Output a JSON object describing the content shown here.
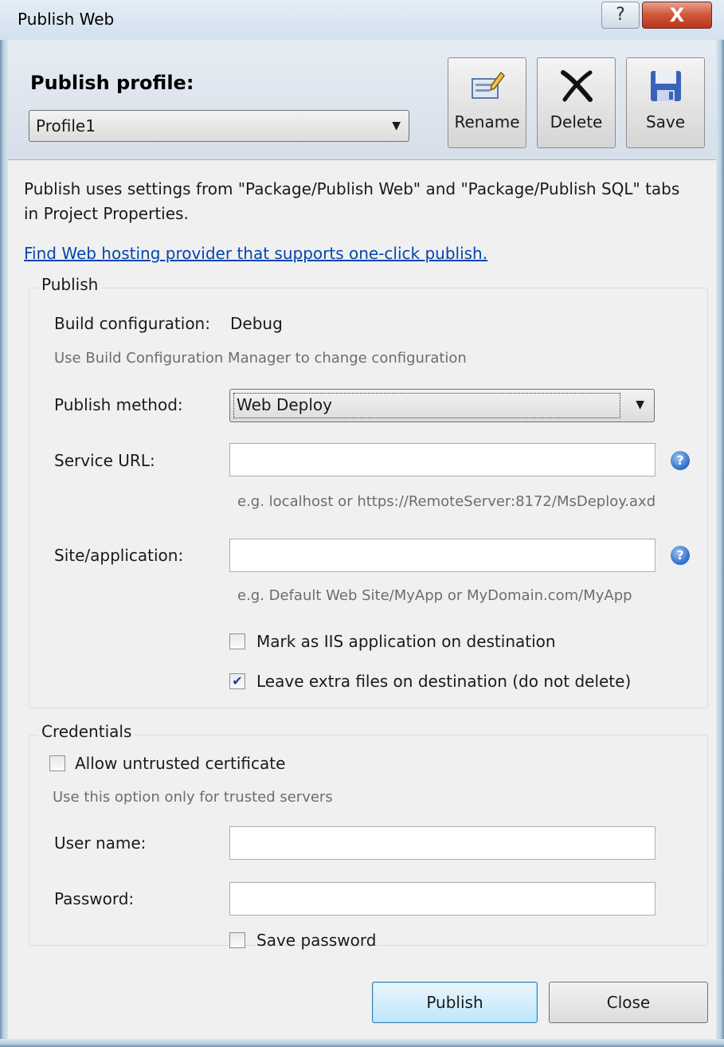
{
  "window": {
    "title": "Publish Web",
    "help_glyph": "?",
    "close_glyph": "X"
  },
  "header": {
    "profile_label": "Publish profile:",
    "profile_value": "Profile1",
    "buttons": {
      "rename": "Rename",
      "delete": "Delete",
      "save": "Save"
    }
  },
  "info": {
    "text": "Publish uses settings from \"Package/Publish Web\" and \"Package/Publish SQL\" tabs in Project Properties.",
    "link": "Find Web hosting provider that supports one-click publish."
  },
  "publish_group": {
    "title": "Publish",
    "build_config_label": "Build configuration:",
    "build_config_value": "Debug",
    "build_config_hint": "Use Build Configuration Manager to change configuration",
    "method_label": "Publish method:",
    "method_value": "Web Deploy",
    "service_url_label": "Service URL:",
    "service_url_value": "",
    "service_url_hint": "e.g. localhost or https://RemoteServer:8172/MsDeploy.axd",
    "site_label": "Site/application:",
    "site_value": "",
    "site_hint": "e.g. Default Web Site/MyApp or MyDomain.com/MyApp",
    "mark_iis_label": "Mark as IIS application on destination",
    "mark_iis_checked": false,
    "leave_files_label": "Leave extra files on destination (do not delete)",
    "leave_files_checked": true,
    "check_glyph": "✔"
  },
  "credentials_group": {
    "title": "Credentials",
    "untrusted_label": "Allow untrusted certificate",
    "untrusted_checked": false,
    "untrusted_hint": "Use this option only for trusted servers",
    "username_label": "User name:",
    "username_value": "",
    "password_label": "Password:",
    "password_value": "",
    "save_password_label": "Save password",
    "save_password_checked": false
  },
  "footer": {
    "publish": "Publish",
    "close": "Close"
  },
  "colors": {
    "accent": "#3c7fb1",
    "link": "#0645ad",
    "close_button": "#c9462b"
  }
}
